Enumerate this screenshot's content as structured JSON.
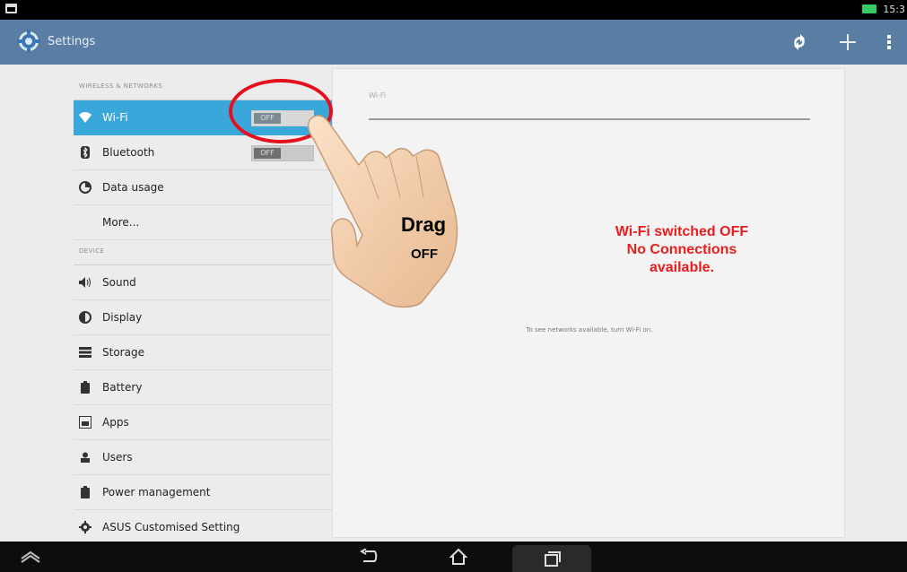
{
  "status_bar": {
    "time": "15:3"
  },
  "action_bar": {
    "title": "Settings"
  },
  "wireless_header": "WIRELESS & NETWORKS",
  "device_header": "DEVICE",
  "wireless_items": [
    {
      "label": "Wi-Fi",
      "toggle": "OFF",
      "selected": true,
      "icon": "wifi-icon"
    },
    {
      "label": "Bluetooth",
      "toggle": "OFF",
      "icon": "bluetooth-icon"
    },
    {
      "label": "Data usage",
      "icon": "data-usage-icon"
    },
    {
      "label": "More..."
    }
  ],
  "device_items": [
    {
      "label": "Sound",
      "icon": "sound-icon"
    },
    {
      "label": "Display",
      "icon": "display-icon"
    },
    {
      "label": "Storage",
      "icon": "storage-icon"
    },
    {
      "label": "Battery",
      "icon": "battery-icon"
    },
    {
      "label": "Apps",
      "icon": "apps-icon"
    },
    {
      "label": "Users",
      "icon": "users-icon"
    },
    {
      "label": "Power management",
      "icon": "power-management-icon"
    },
    {
      "label": "ASUS Customised Setting",
      "icon": "gear-icon"
    }
  ],
  "pane": {
    "title": "Wi-Fi",
    "hint": "To see networks available, turn Wi-Fi on."
  },
  "annotation": {
    "line1": "Wi-Fi switched OFF",
    "line2": "No Connections",
    "line3": "available.",
    "drag": "Drag",
    "off": "OFF"
  },
  "colors": {
    "action_bar": "#5a7ea3",
    "selected": "#3aa7da",
    "annotation_red": "#e81e1e"
  }
}
